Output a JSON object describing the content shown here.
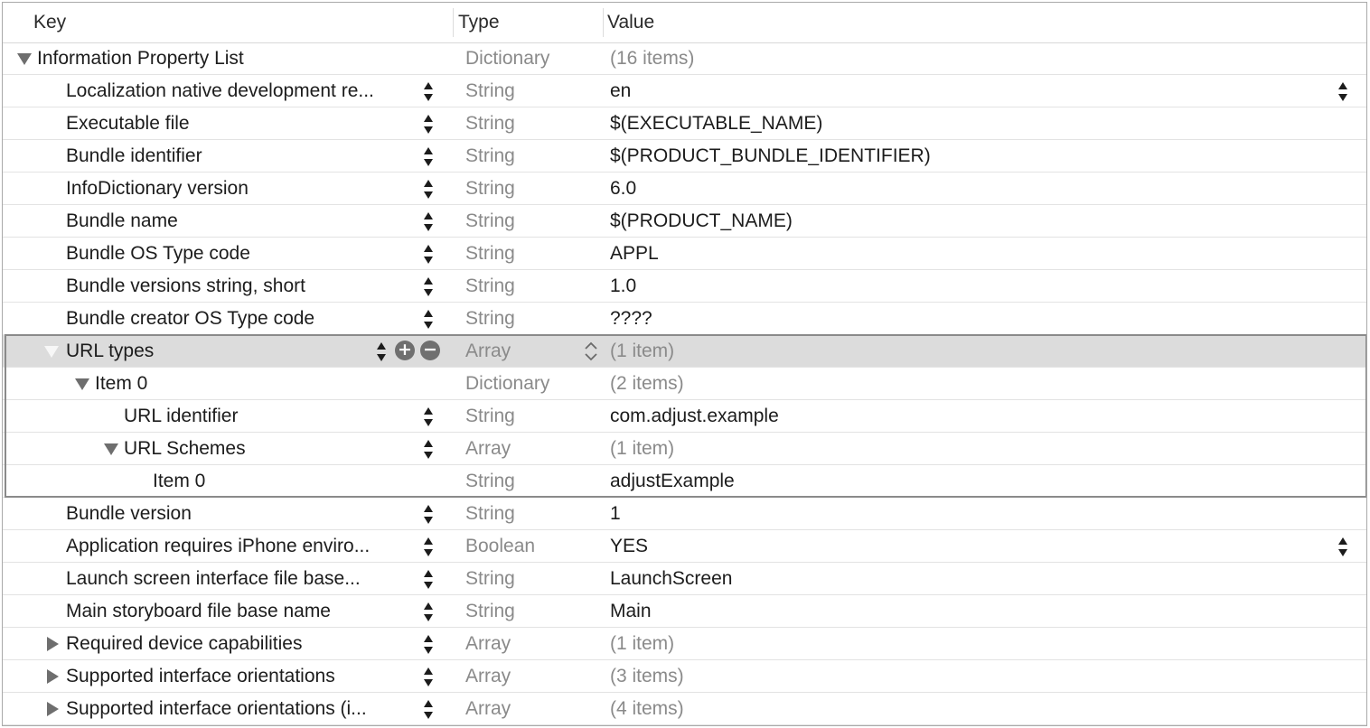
{
  "columns": {
    "key": "Key",
    "type": "Type",
    "value": "Value"
  },
  "rows": [
    {
      "key": "Information Property List",
      "type": "Dictionary",
      "value": "(16 items)",
      "value_muted": true,
      "depth": 0,
      "disclosure": "open",
      "key_stepper": false,
      "value_stepper": false
    },
    {
      "key": "Localization native development re...",
      "type": "String",
      "value": "en",
      "depth": 1,
      "key_stepper": true,
      "value_stepper": true
    },
    {
      "key": "Executable file",
      "type": "String",
      "value": "$(EXECUTABLE_NAME)",
      "depth": 1,
      "key_stepper": true
    },
    {
      "key": "Bundle identifier",
      "type": "String",
      "value": "$(PRODUCT_BUNDLE_IDENTIFIER)",
      "depth": 1,
      "key_stepper": true
    },
    {
      "key": "InfoDictionary version",
      "type": "String",
      "value": "6.0",
      "depth": 1,
      "key_stepper": true
    },
    {
      "key": "Bundle name",
      "type": "String",
      "value": "$(PRODUCT_NAME)",
      "depth": 1,
      "key_stepper": true
    },
    {
      "key": "Bundle OS Type code",
      "type": "String",
      "value": "APPL",
      "depth": 1,
      "key_stepper": true
    },
    {
      "key": "Bundle versions string, short",
      "type": "String",
      "value": "1.0",
      "depth": 1,
      "key_stepper": true
    },
    {
      "key": "Bundle creator OS Type code",
      "type": "String",
      "value": "????",
      "depth": 1,
      "key_stepper": true
    },
    {
      "key": "URL types",
      "type": "Array",
      "value": "(1 item)",
      "value_muted": true,
      "depth": 1,
      "disclosure": "open",
      "selected": true,
      "key_stepper": true,
      "add_remove": true,
      "type_popup": true
    },
    {
      "key": "Item 0",
      "type": "Dictionary",
      "value": "(2 items)",
      "value_muted": true,
      "depth": 2,
      "disclosure": "open",
      "key_stepper": false
    },
    {
      "key": "URL identifier",
      "type": "String",
      "value": "com.adjust.example",
      "depth": 3,
      "key_stepper": true
    },
    {
      "key": "URL Schemes",
      "type": "Array",
      "value": "(1 item)",
      "value_muted": true,
      "depth": 3,
      "disclosure": "open",
      "key_stepper": true
    },
    {
      "key": "Item 0",
      "type": "String",
      "value": "adjustExample",
      "depth": 4,
      "key_stepper": false
    },
    {
      "key": "Bundle version",
      "type": "String",
      "value": "1",
      "depth": 1,
      "key_stepper": true
    },
    {
      "key": "Application requires iPhone enviro...",
      "type": "Boolean",
      "value": "YES",
      "depth": 1,
      "key_stepper": true,
      "value_stepper": true
    },
    {
      "key": "Launch screen interface file base...",
      "type": "String",
      "value": "LaunchScreen",
      "depth": 1,
      "key_stepper": true
    },
    {
      "key": "Main storyboard file base name",
      "type": "String",
      "value": "Main",
      "depth": 1,
      "key_stepper": true
    },
    {
      "key": "Required device capabilities",
      "type": "Array",
      "value": "(1 item)",
      "value_muted": true,
      "depth": 1,
      "disclosure": "closed",
      "key_stepper": true
    },
    {
      "key": "Supported interface orientations",
      "type": "Array",
      "value": "(3 items)",
      "value_muted": true,
      "depth": 1,
      "disclosure": "closed",
      "key_stepper": true
    },
    {
      "key": "Supported interface orientations (i...",
      "type": "Array",
      "value": "(4 items)",
      "value_muted": true,
      "depth": 1,
      "disclosure": "closed",
      "key_stepper": true
    }
  ],
  "icons": {
    "add": "plus-circle-icon",
    "remove": "minus-circle-icon",
    "stepper": "up-down-stepper-icon",
    "popup": "chevron-up-down-icon"
  },
  "colors": {
    "selected_row": "#dcdcdc",
    "muted_text": "#8a8a8a",
    "disclosure": "#6e6e6e"
  }
}
